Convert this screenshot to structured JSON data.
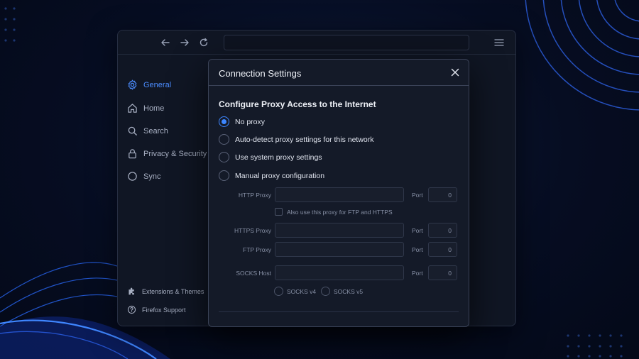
{
  "toolbar": {
    "back_icon": "arrow-left-icon",
    "forward_icon": "arrow-right-icon",
    "reload_icon": "reload-icon",
    "menu_icon": "hamburger-menu-icon",
    "url_value": ""
  },
  "sidebar": {
    "items": [
      {
        "label": "General",
        "icon": "gear-icon",
        "active": true
      },
      {
        "label": "Home",
        "icon": "home-icon"
      },
      {
        "label": "Search",
        "icon": "search-icon"
      },
      {
        "label": "Privacy & Security",
        "icon": "lock-icon"
      },
      {
        "label": "Sync",
        "icon": "sync-icon"
      }
    ],
    "footer": [
      {
        "label": "Extensions & Themes",
        "icon": "puzzle-icon"
      },
      {
        "label": "Firefox Support",
        "icon": "help-icon"
      }
    ]
  },
  "dialog": {
    "title": "Connection Settings",
    "close_icon": "close-icon",
    "section_title": "Configure Proxy Access to the Internet",
    "options": [
      {
        "label": "No proxy",
        "checked": true
      },
      {
        "label": "Auto-detect proxy settings for this network",
        "checked": false
      },
      {
        "label": "Use system proxy settings",
        "checked": false
      },
      {
        "label": "Manual proxy configuration",
        "checked": false
      }
    ],
    "http_proxy": {
      "label": "HTTP Proxy",
      "value": "",
      "port_label": "Port",
      "port": "0"
    },
    "also_use_label": "Also use this proxy for FTP and HTTPS",
    "https_proxy": {
      "label": "HTTPS Proxy",
      "value": "",
      "port_label": "Port",
      "port": "0"
    },
    "ftp_proxy": {
      "label": "FTP Proxy",
      "value": "",
      "port_label": "Port",
      "port": "0"
    },
    "socks_host": {
      "label": "SOCKS Host",
      "value": "",
      "port_label": "Port",
      "port": "0"
    },
    "socks_v4_label": "SOCKS v4",
    "socks_v5_label": "SOCKS v5"
  },
  "colors": {
    "accent": "#3d86ff",
    "background": "#060d22",
    "dialog_bg": "#141a28"
  }
}
